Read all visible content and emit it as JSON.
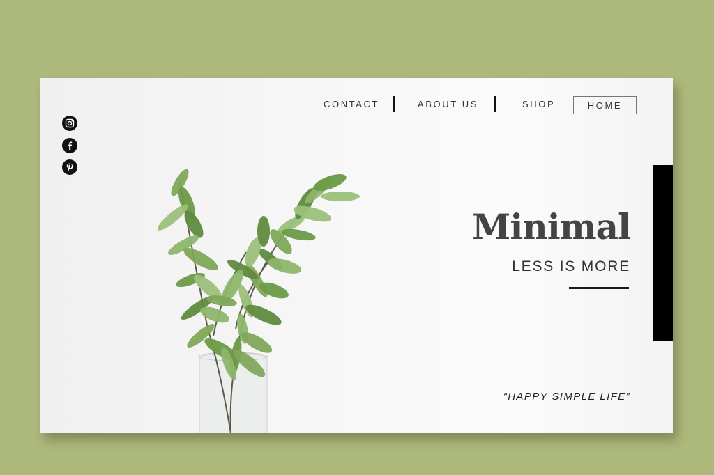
{
  "nav": {
    "contact": "CONTACT",
    "about": "ABOUT US",
    "shop": "SHOP",
    "home": "HOME"
  },
  "social": [
    "instagram-icon",
    "facebook-icon",
    "pinterest-icon"
  ],
  "hero": {
    "title": "Minimal",
    "subtitle": "LESS IS MORE",
    "quote": "“HAPPY SIMPLE LIFE”"
  },
  "colors": {
    "background": "#adb87b",
    "card": "#f7f7f7",
    "accent_bar": "#000000",
    "leaf": "#7fa85a"
  }
}
